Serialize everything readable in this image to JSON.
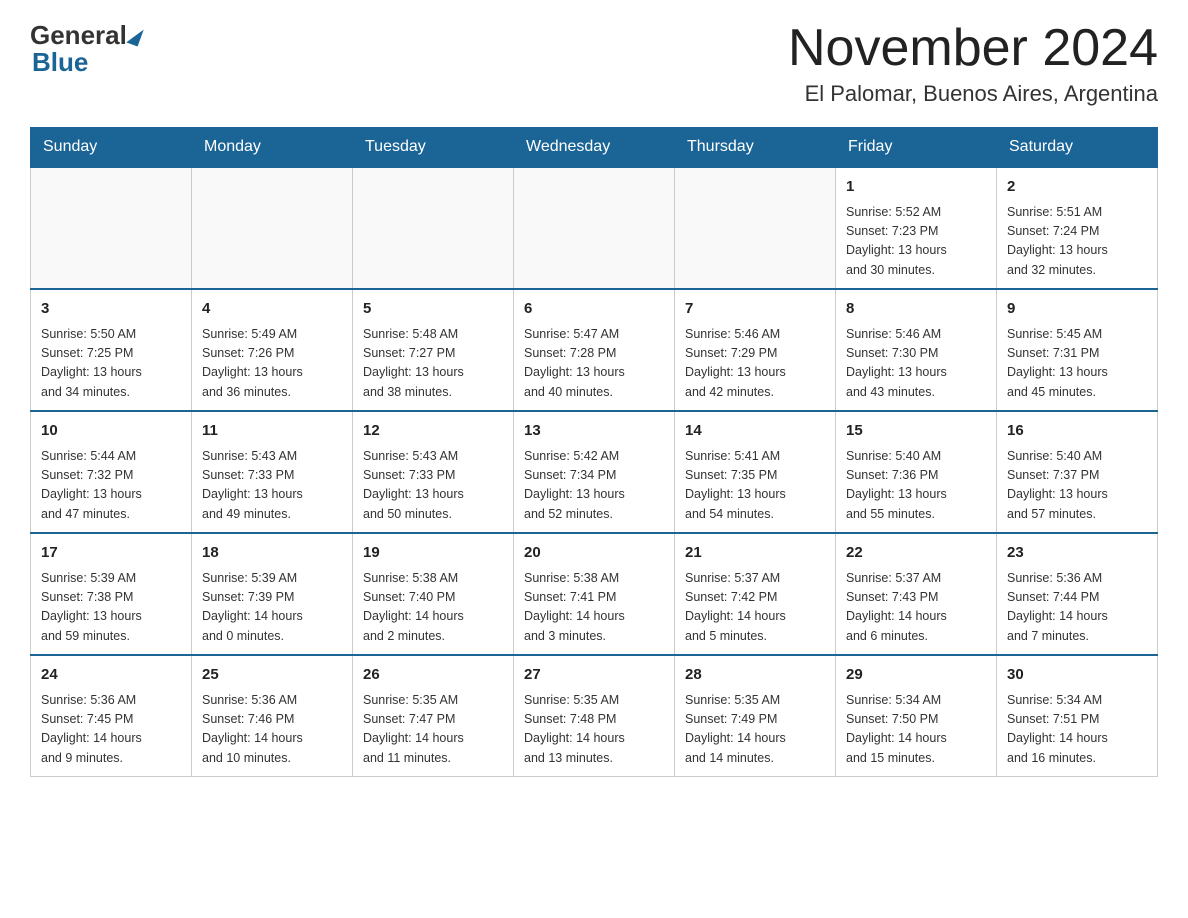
{
  "header": {
    "logo_general": "General",
    "logo_blue": "Blue",
    "month_title": "November 2024",
    "location": "El Palomar, Buenos Aires, Argentina"
  },
  "days_of_week": [
    "Sunday",
    "Monday",
    "Tuesday",
    "Wednesday",
    "Thursday",
    "Friday",
    "Saturday"
  ],
  "weeks": [
    [
      {
        "day": "",
        "info": ""
      },
      {
        "day": "",
        "info": ""
      },
      {
        "day": "",
        "info": ""
      },
      {
        "day": "",
        "info": ""
      },
      {
        "day": "",
        "info": ""
      },
      {
        "day": "1",
        "info": "Sunrise: 5:52 AM\nSunset: 7:23 PM\nDaylight: 13 hours\nand 30 minutes."
      },
      {
        "day": "2",
        "info": "Sunrise: 5:51 AM\nSunset: 7:24 PM\nDaylight: 13 hours\nand 32 minutes."
      }
    ],
    [
      {
        "day": "3",
        "info": "Sunrise: 5:50 AM\nSunset: 7:25 PM\nDaylight: 13 hours\nand 34 minutes."
      },
      {
        "day": "4",
        "info": "Sunrise: 5:49 AM\nSunset: 7:26 PM\nDaylight: 13 hours\nand 36 minutes."
      },
      {
        "day": "5",
        "info": "Sunrise: 5:48 AM\nSunset: 7:27 PM\nDaylight: 13 hours\nand 38 minutes."
      },
      {
        "day": "6",
        "info": "Sunrise: 5:47 AM\nSunset: 7:28 PM\nDaylight: 13 hours\nand 40 minutes."
      },
      {
        "day": "7",
        "info": "Sunrise: 5:46 AM\nSunset: 7:29 PM\nDaylight: 13 hours\nand 42 minutes."
      },
      {
        "day": "8",
        "info": "Sunrise: 5:46 AM\nSunset: 7:30 PM\nDaylight: 13 hours\nand 43 minutes."
      },
      {
        "day": "9",
        "info": "Sunrise: 5:45 AM\nSunset: 7:31 PM\nDaylight: 13 hours\nand 45 minutes."
      }
    ],
    [
      {
        "day": "10",
        "info": "Sunrise: 5:44 AM\nSunset: 7:32 PM\nDaylight: 13 hours\nand 47 minutes."
      },
      {
        "day": "11",
        "info": "Sunrise: 5:43 AM\nSunset: 7:33 PM\nDaylight: 13 hours\nand 49 minutes."
      },
      {
        "day": "12",
        "info": "Sunrise: 5:43 AM\nSunset: 7:33 PM\nDaylight: 13 hours\nand 50 minutes."
      },
      {
        "day": "13",
        "info": "Sunrise: 5:42 AM\nSunset: 7:34 PM\nDaylight: 13 hours\nand 52 minutes."
      },
      {
        "day": "14",
        "info": "Sunrise: 5:41 AM\nSunset: 7:35 PM\nDaylight: 13 hours\nand 54 minutes."
      },
      {
        "day": "15",
        "info": "Sunrise: 5:40 AM\nSunset: 7:36 PM\nDaylight: 13 hours\nand 55 minutes."
      },
      {
        "day": "16",
        "info": "Sunrise: 5:40 AM\nSunset: 7:37 PM\nDaylight: 13 hours\nand 57 minutes."
      }
    ],
    [
      {
        "day": "17",
        "info": "Sunrise: 5:39 AM\nSunset: 7:38 PM\nDaylight: 13 hours\nand 59 minutes."
      },
      {
        "day": "18",
        "info": "Sunrise: 5:39 AM\nSunset: 7:39 PM\nDaylight: 14 hours\nand 0 minutes."
      },
      {
        "day": "19",
        "info": "Sunrise: 5:38 AM\nSunset: 7:40 PM\nDaylight: 14 hours\nand 2 minutes."
      },
      {
        "day": "20",
        "info": "Sunrise: 5:38 AM\nSunset: 7:41 PM\nDaylight: 14 hours\nand 3 minutes."
      },
      {
        "day": "21",
        "info": "Sunrise: 5:37 AM\nSunset: 7:42 PM\nDaylight: 14 hours\nand 5 minutes."
      },
      {
        "day": "22",
        "info": "Sunrise: 5:37 AM\nSunset: 7:43 PM\nDaylight: 14 hours\nand 6 minutes."
      },
      {
        "day": "23",
        "info": "Sunrise: 5:36 AM\nSunset: 7:44 PM\nDaylight: 14 hours\nand 7 minutes."
      }
    ],
    [
      {
        "day": "24",
        "info": "Sunrise: 5:36 AM\nSunset: 7:45 PM\nDaylight: 14 hours\nand 9 minutes."
      },
      {
        "day": "25",
        "info": "Sunrise: 5:36 AM\nSunset: 7:46 PM\nDaylight: 14 hours\nand 10 minutes."
      },
      {
        "day": "26",
        "info": "Sunrise: 5:35 AM\nSunset: 7:47 PM\nDaylight: 14 hours\nand 11 minutes."
      },
      {
        "day": "27",
        "info": "Sunrise: 5:35 AM\nSunset: 7:48 PM\nDaylight: 14 hours\nand 13 minutes."
      },
      {
        "day": "28",
        "info": "Sunrise: 5:35 AM\nSunset: 7:49 PM\nDaylight: 14 hours\nand 14 minutes."
      },
      {
        "day": "29",
        "info": "Sunrise: 5:34 AM\nSunset: 7:50 PM\nDaylight: 14 hours\nand 15 minutes."
      },
      {
        "day": "30",
        "info": "Sunrise: 5:34 AM\nSunset: 7:51 PM\nDaylight: 14 hours\nand 16 minutes."
      }
    ]
  ]
}
